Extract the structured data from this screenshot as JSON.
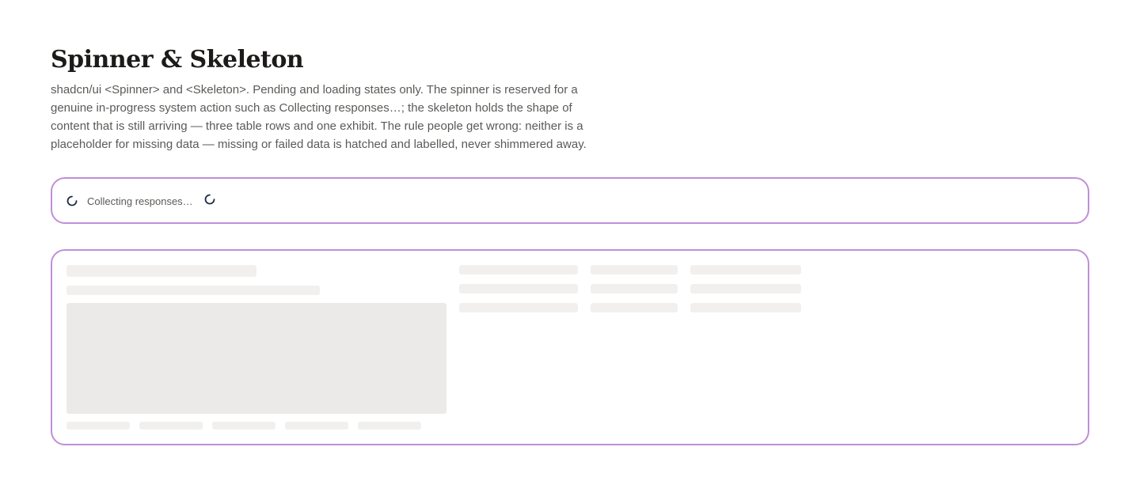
{
  "header": {
    "title": "Spinner & Skeleton",
    "description": "shadcn/ui <Spinner> and <Skeleton>. Pending and loading states only. The spinner is reserved for a genuine in-progress system action such as Collecting responses…; the skeleton holds the shape of content that is still arriving — three table rows and one exhibit. The rule people get wrong: neither is a placeholder for missing data — missing or failed data is hatched and labelled, never shimmered away."
  },
  "spinner_panel": {
    "label": "Collecting responses…",
    "spinner_icon": "spinner-icon",
    "accent_color": "#1e2a44"
  },
  "skeleton_panel": {
    "table_rows": 3,
    "table_columns": 3,
    "exhibit_count": 1,
    "exhibit_footer_items": 5
  },
  "colors": {
    "panel_border": "#c08fd6",
    "skeleton_fill": "#f1f0ef",
    "skeleton_block": "#ebeae8",
    "text_muted": "#5c5a57"
  }
}
